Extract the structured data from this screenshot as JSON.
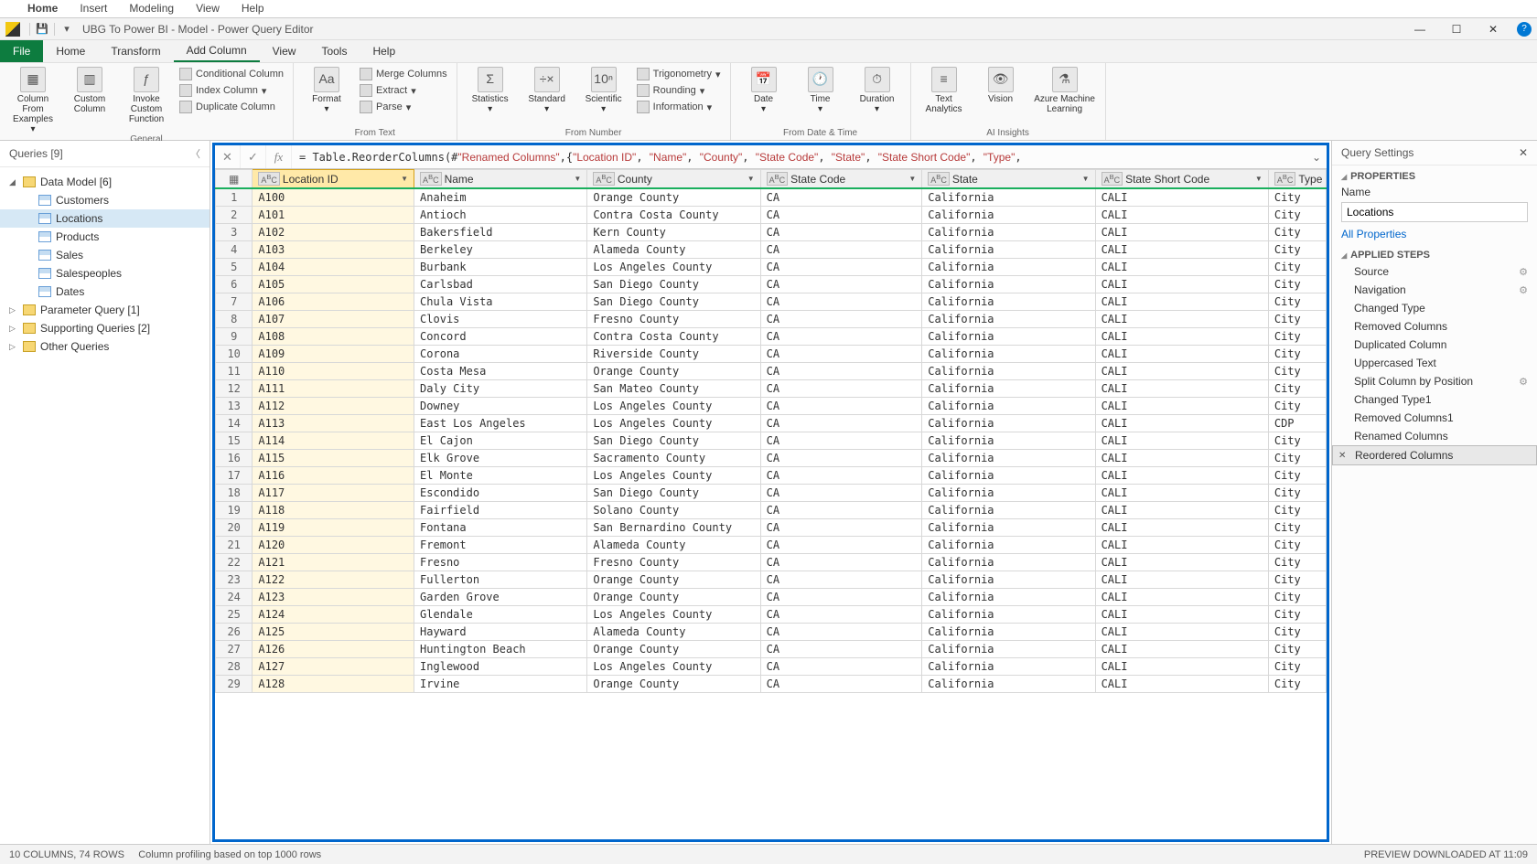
{
  "topTabs": [
    "Home",
    "Insert",
    "Modeling",
    "View",
    "Help"
  ],
  "titleBar": {
    "title": "UBG To Power BI - Model - Power Query Editor"
  },
  "ribbonTabs": [
    "File",
    "Home",
    "Transform",
    "Add Column",
    "View",
    "Tools",
    "Help"
  ],
  "ribbonActive": "Add Column",
  "ribbon": {
    "general": {
      "label": "General",
      "btns": [
        {
          "label": "Column From Examples"
        },
        {
          "label": "Custom Column"
        },
        {
          "label": "Invoke Custom Function"
        }
      ],
      "items": [
        "Conditional Column",
        "Index Column",
        "Duplicate Column"
      ]
    },
    "fromText": {
      "label": "From Text",
      "btns": [
        {
          "label": "Format"
        }
      ],
      "items": [
        "Merge Columns",
        "Extract",
        "Parse"
      ]
    },
    "fromNumber": {
      "label": "From Number",
      "btns": [
        {
          "label": "Statistics"
        },
        {
          "label": "Standard"
        },
        {
          "label": "Scientific"
        }
      ],
      "items": [
        "Trigonometry",
        "Rounding",
        "Information"
      ]
    },
    "fromDate": {
      "label": "From Date & Time",
      "btns": [
        {
          "label": "Date"
        },
        {
          "label": "Time"
        },
        {
          "label": "Duration"
        }
      ]
    },
    "ai": {
      "label": "AI Insights",
      "btns": [
        {
          "label": "Text Analytics"
        },
        {
          "label": "Vision"
        },
        {
          "label": "Azure Machine Learning"
        }
      ]
    }
  },
  "queriesPane": {
    "title": "Queries [9]",
    "groups": [
      {
        "name": "Data Model [6]",
        "expanded": true,
        "children": [
          "Customers",
          "Locations",
          "Products",
          "Sales",
          "Salespeoples",
          "Dates"
        ],
        "selected": "Locations"
      },
      {
        "name": "Parameter Query [1]",
        "expanded": false
      },
      {
        "name": "Supporting Queries [2]",
        "expanded": false
      },
      {
        "name": "Other Queries",
        "expanded": false
      }
    ]
  },
  "formula": {
    "prefix": "= Table.ReorderColumns(#",
    "s0": "\"Renamed Columns\"",
    "mid": ",{",
    "args": [
      "\"Location ID\"",
      "\"Name\"",
      "\"County\"",
      "\"State Code\"",
      "\"State\"",
      "\"State Short Code\"",
      "\"Type\""
    ],
    "suffix": ","
  },
  "gridHeaders": [
    "Location ID",
    "Name",
    "County",
    "State Code",
    "State",
    "State Short Code",
    "Type"
  ],
  "selectedColumn": 0,
  "rows": [
    [
      "A100",
      "Anaheim",
      "Orange County",
      "CA",
      "California",
      "CALI",
      "City"
    ],
    [
      "A101",
      "Antioch",
      "Contra Costa County",
      "CA",
      "California",
      "CALI",
      "City"
    ],
    [
      "A102",
      "Bakersfield",
      "Kern County",
      "CA",
      "California",
      "CALI",
      "City"
    ],
    [
      "A103",
      "Berkeley",
      "Alameda County",
      "CA",
      "California",
      "CALI",
      "City"
    ],
    [
      "A104",
      "Burbank",
      "Los Angeles County",
      "CA",
      "California",
      "CALI",
      "City"
    ],
    [
      "A105",
      "Carlsbad",
      "San Diego County",
      "CA",
      "California",
      "CALI",
      "City"
    ],
    [
      "A106",
      "Chula Vista",
      "San Diego County",
      "CA",
      "California",
      "CALI",
      "City"
    ],
    [
      "A107",
      "Clovis",
      "Fresno County",
      "CA",
      "California",
      "CALI",
      "City"
    ],
    [
      "A108",
      "Concord",
      "Contra Costa County",
      "CA",
      "California",
      "CALI",
      "City"
    ],
    [
      "A109",
      "Corona",
      "Riverside County",
      "CA",
      "California",
      "CALI",
      "City"
    ],
    [
      "A110",
      "Costa Mesa",
      "Orange County",
      "CA",
      "California",
      "CALI",
      "City"
    ],
    [
      "A111",
      "Daly City",
      "San Mateo County",
      "CA",
      "California",
      "CALI",
      "City"
    ],
    [
      "A112",
      "Downey",
      "Los Angeles County",
      "CA",
      "California",
      "CALI",
      "City"
    ],
    [
      "A113",
      "East Los Angeles",
      "Los Angeles County",
      "CA",
      "California",
      "CALI",
      "CDP"
    ],
    [
      "A114",
      "El Cajon",
      "San Diego County",
      "CA",
      "California",
      "CALI",
      "City"
    ],
    [
      "A115",
      "Elk Grove",
      "Sacramento County",
      "CA",
      "California",
      "CALI",
      "City"
    ],
    [
      "A116",
      "El Monte",
      "Los Angeles County",
      "CA",
      "California",
      "CALI",
      "City"
    ],
    [
      "A117",
      "Escondido",
      "San Diego County",
      "CA",
      "California",
      "CALI",
      "City"
    ],
    [
      "A118",
      "Fairfield",
      "Solano County",
      "CA",
      "California",
      "CALI",
      "City"
    ],
    [
      "A119",
      "Fontana",
      "San Bernardino County",
      "CA",
      "California",
      "CALI",
      "City"
    ],
    [
      "A120",
      "Fremont",
      "Alameda County",
      "CA",
      "California",
      "CALI",
      "City"
    ],
    [
      "A121",
      "Fresno",
      "Fresno County",
      "CA",
      "California",
      "CALI",
      "City"
    ],
    [
      "A122",
      "Fullerton",
      "Orange County",
      "CA",
      "California",
      "CALI",
      "City"
    ],
    [
      "A123",
      "Garden Grove",
      "Orange County",
      "CA",
      "California",
      "CALI",
      "City"
    ],
    [
      "A124",
      "Glendale",
      "Los Angeles County",
      "CA",
      "California",
      "CALI",
      "City"
    ],
    [
      "A125",
      "Hayward",
      "Alameda County",
      "CA",
      "California",
      "CALI",
      "City"
    ],
    [
      "A126",
      "Huntington Beach",
      "Orange County",
      "CA",
      "California",
      "CALI",
      "City"
    ],
    [
      "A127",
      "Inglewood",
      "Los Angeles County",
      "CA",
      "California",
      "CALI",
      "City"
    ],
    [
      "A128",
      "Irvine",
      "Orange County",
      "CA",
      "California",
      "CALI",
      "City"
    ]
  ],
  "querySettings": {
    "title": "Query Settings",
    "propertiesLabel": "PROPERTIES",
    "nameLabel": "Name",
    "nameValue": "Locations",
    "allProps": "All Properties",
    "appliedLabel": "APPLIED STEPS",
    "steps": [
      {
        "name": "Source",
        "gear": true
      },
      {
        "name": "Navigation",
        "gear": true
      },
      {
        "name": "Changed Type"
      },
      {
        "name": "Removed Columns"
      },
      {
        "name": "Duplicated Column"
      },
      {
        "name": "Uppercased Text"
      },
      {
        "name": "Split Column by Position",
        "gear": true
      },
      {
        "name": "Changed Type1"
      },
      {
        "name": "Removed Columns1"
      },
      {
        "name": "Renamed Columns"
      },
      {
        "name": "Reordered Columns",
        "selected": true
      }
    ]
  },
  "status": {
    "left": "10 COLUMNS, 74 ROWS",
    "mid": "Column profiling based on top 1000 rows",
    "right": "PREVIEW DOWNLOADED AT 11:09"
  }
}
